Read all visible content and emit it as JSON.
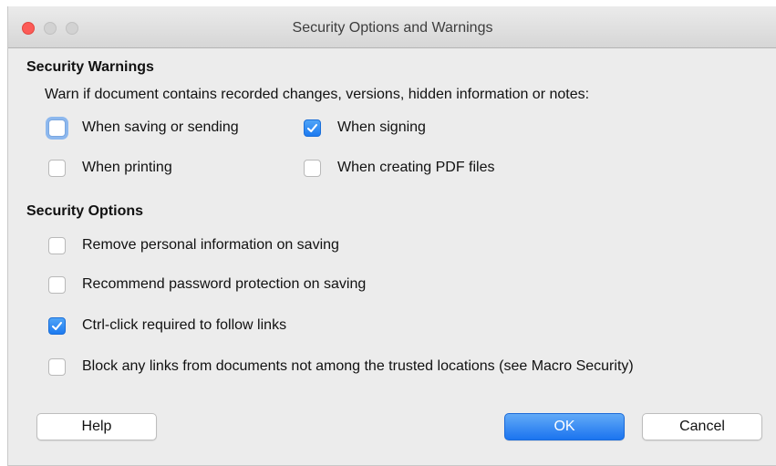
{
  "window": {
    "title": "Security Options and Warnings"
  },
  "warnings": {
    "heading": "Security Warnings",
    "description": "Warn if document contains recorded changes, versions, hidden information or notes:",
    "options": [
      {
        "label": "When saving or sending",
        "checked": false
      },
      {
        "label": "When signing",
        "checked": true
      },
      {
        "label": "When printing",
        "checked": false
      },
      {
        "label": "When creating PDF files",
        "checked": false
      }
    ]
  },
  "options": {
    "heading": "Security Options",
    "items": [
      {
        "label": "Remove personal information on saving",
        "checked": false
      },
      {
        "label": "Recommend password protection on saving",
        "checked": false
      },
      {
        "label": "Ctrl-click required to follow links",
        "checked": true
      },
      {
        "label": "Block any links from documents not among the trusted locations (see Macro Security)",
        "checked": false
      }
    ]
  },
  "buttons": {
    "help": "Help",
    "ok": "OK",
    "cancel": "Cancel"
  },
  "colors": {
    "close": "#fc5b57",
    "accent": "#1c7af0",
    "background": "#ececec"
  }
}
